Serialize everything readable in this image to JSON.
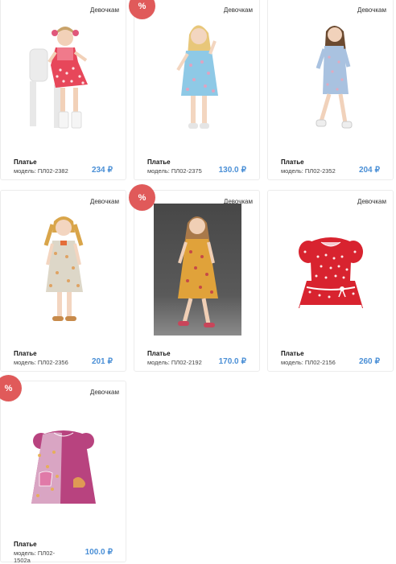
{
  "products": [
    {
      "category": "Девочкам",
      "name": "Платье",
      "model": "модель: ПЛ02-2382",
      "price": "234",
      "currency": "₽",
      "sale": false,
      "dress_color": "#e7475a",
      "dress_pattern": "polka"
    },
    {
      "category": "Девочкам",
      "name": "Платье",
      "model": "модель: ПЛ02-2375",
      "price": "130.0",
      "currency": "₽",
      "sale": true,
      "sale_label": "%",
      "dress_color": "#8ec9e6",
      "dress_pattern": "floral"
    },
    {
      "category": "Девочкам",
      "name": "Платье",
      "model": "модель: ПЛ02-2352",
      "price": "204",
      "currency": "₽",
      "sale": false,
      "dress_color": "#a9c2e0",
      "dress_pattern": "floral"
    },
    {
      "category": "Девочкам",
      "name": "Платье",
      "model": "модель: ПЛ02-2356",
      "price": "201",
      "currency": "₽",
      "sale": false,
      "dress_color": "#ddd7c8",
      "dress_pattern": "floral"
    },
    {
      "category": "Девочкам",
      "name": "Платье",
      "model": "модель: ПЛ02-2192",
      "price": "170.0",
      "currency": "₽",
      "sale": true,
      "sale_label": "%",
      "dress_color": "#e0a23a",
      "dress_pattern": "floral"
    },
    {
      "category": "Девочкам",
      "name": "Платье",
      "model": "модель: ПЛ02-2156",
      "price": "260",
      "currency": "₽",
      "sale": false,
      "dress_color": "#d8232f",
      "dress_pattern": "polka"
    },
    {
      "category": "Девочкам",
      "name": "Платье",
      "model": "модель: ПЛ02-1502a",
      "price": "100.0",
      "currency": "₽",
      "sale": true,
      "sale_label": "%",
      "dress_color": "#b8437f",
      "dress_pattern": "floral"
    }
  ]
}
